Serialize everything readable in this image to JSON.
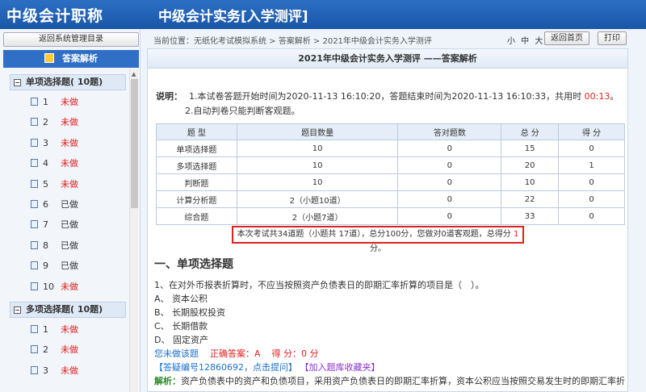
{
  "header": {
    "logo": "中级会计职称",
    "title": "中级会计实务[入学测评]"
  },
  "sidebar": {
    "back_label": "返回系统管理目录",
    "answer_header": "答案解析",
    "groups": [
      {
        "label": "单项选择题( 10题)",
        "toggle": "−",
        "items": [
          {
            "num": "1",
            "status": "未做"
          },
          {
            "num": "2",
            "status": "未做"
          },
          {
            "num": "3",
            "status": "未做"
          },
          {
            "num": "4",
            "status": "未做"
          },
          {
            "num": "5",
            "status": "未做"
          },
          {
            "num": "6",
            "status": "已做"
          },
          {
            "num": "7",
            "status": "已做"
          },
          {
            "num": "8",
            "status": "已做"
          },
          {
            "num": "9",
            "status": "已做"
          },
          {
            "num": "10",
            "status": "未做"
          }
        ]
      },
      {
        "label": "多项选择题( 10题)",
        "toggle": "−",
        "items": [
          {
            "num": "1",
            "status": "未做"
          },
          {
            "num": "2",
            "status": "未做"
          },
          {
            "num": "3",
            "status": "未做"
          }
        ]
      }
    ]
  },
  "topbar": {
    "breadcrumb": "当前位置：无纸化考试模拟系统 > 答案解析 > 2021年中级会计实务入学测评",
    "font_sizes": "小 中 大",
    "home_label": "返回首页",
    "print_label": "打印"
  },
  "main": {
    "title": "2021年中级会计实务入学测评 ——答案解析",
    "note_label": "说明：",
    "note_line1_prefix": "1.本试卷答题开始时间为2020-11-13 16:10:20，答题结束时间为2020-11-13 16:10:33，共用时",
    "note_time": "00:13",
    "note_line1_suffix": "。",
    "note_line2": "2.自动判卷只能判断客观题。",
    "table": {
      "headers": [
        "题 型",
        "题目数量",
        "答对题数",
        "总 分",
        "得 分"
      ],
      "rows": [
        [
          "单项选择题",
          "10",
          "0",
          "15",
          "0"
        ],
        [
          "多项选择题",
          "10",
          "0",
          "20",
          "1"
        ],
        [
          "判断题",
          "10",
          "0",
          "10",
          "0"
        ],
        [
          "计算分析题",
          "2（小题10道）",
          "0",
          "22",
          "0"
        ],
        [
          "综合题",
          "2（小题7道）",
          "0",
          "33",
          "0"
        ]
      ]
    },
    "summary_prefix": "本次考试共34道题（小题共 17道），总分100分，您做对0道客观题，总得分",
    "summary_score": "1",
    "summary_suffix": "分。",
    "section_title": "一、单项选择题",
    "question": {
      "stem": "1、在对外币报表折算时，不应当按照资产负债表日的即期汇率折算的项目是（　）。",
      "options": [
        "A、 资本公积",
        "B、 长期股权投资",
        "C、 长期借款",
        "D、 固定资产"
      ],
      "status_text": "您未做该题",
      "correct_text": "正确答案：A",
      "score_text": "得 分：0  分",
      "qa_link": "【答疑编号12860692，点击提问】",
      "fav_link": "【加入题库收藏夹】",
      "analysis_label": "解析：",
      "analysis_text": "资产负债表中的资产和负债项目，采用资产负债表日的即期汇率折算，资本公积应当按照交易发生时的即期汇率折"
    }
  },
  "colors": {
    "header": "#1a56a8",
    "undone": "#e02020",
    "summary_border": "#e02020",
    "link_blue": "#1a6fc9"
  }
}
